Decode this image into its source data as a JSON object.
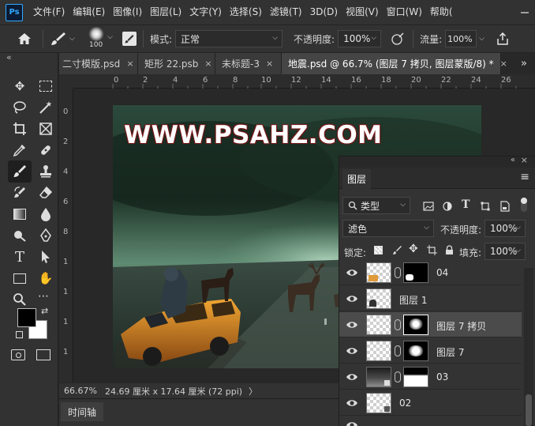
{
  "app": {
    "logo": "Ps"
  },
  "menu": [
    "文件(F)",
    "编辑(E)",
    "图像(I)",
    "图层(L)",
    "文字(Y)",
    "选择(S)",
    "滤镜(T)",
    "3D(D)",
    "视图(V)",
    "窗口(W)",
    "帮助("
  ],
  "options": {
    "brush_size": "100",
    "mode_label": "模式:",
    "mode_value": "正常",
    "opacity_label": "不透明度:",
    "opacity_value": "100%",
    "flow_label": "流量:",
    "flow_value": "100%"
  },
  "tabs": [
    {
      "label": "二寸模版.psd",
      "close": "×"
    },
    {
      "label": "矩形 22.psb",
      "close": "×"
    },
    {
      "label": "未标题-3",
      "close": "×"
    },
    {
      "label": "地震.psd @ 66.7% (图层 7 拷贝, 图层蒙版/8) *",
      "close": "×"
    }
  ],
  "tab_overflow": "»",
  "panel_collapse": "«",
  "ruler_top": [
    "0",
    "2",
    "4",
    "6",
    "8",
    "10",
    "12",
    "14",
    "16",
    "18",
    "20",
    "22",
    "24",
    "26"
  ],
  "ruler_left": [
    "0",
    "2",
    "4",
    "6",
    "8",
    "1",
    "1",
    "1",
    "1"
  ],
  "canvas": {
    "watermark": "WWW.PSAHZ.COM"
  },
  "status": {
    "zoom": "66.67%",
    "doc_info": "24.69 厘米 x 17.64 厘米 (72 ppi)",
    "arrow": "〉"
  },
  "timeline": {
    "label": "时间轴"
  },
  "layers_panel": {
    "title": "图层",
    "filter_kind": "类型",
    "blend_mode": "滤色",
    "opacity_label": "不透明度:",
    "opacity_value": "100%",
    "lock_label": "锁定:",
    "fill_label": "填充:",
    "fill_value": "100%",
    "collapse": "«",
    "close": "×",
    "menu": "≡",
    "layers": [
      {
        "name": "04",
        "visible": true,
        "selected": false
      },
      {
        "name": "图层 1",
        "visible": true,
        "selected": false
      },
      {
        "name": "图层 7 拷贝",
        "visible": true,
        "selected": true
      },
      {
        "name": "图层 7",
        "visible": true,
        "selected": false
      },
      {
        "name": "03",
        "visible": true,
        "selected": false
      },
      {
        "name": "02",
        "visible": true,
        "selected": false
      }
    ]
  },
  "icons": {
    "home": "home-icon",
    "brush": "brush-icon",
    "airbrush": "airbrush-icon",
    "share": "share-icon"
  }
}
